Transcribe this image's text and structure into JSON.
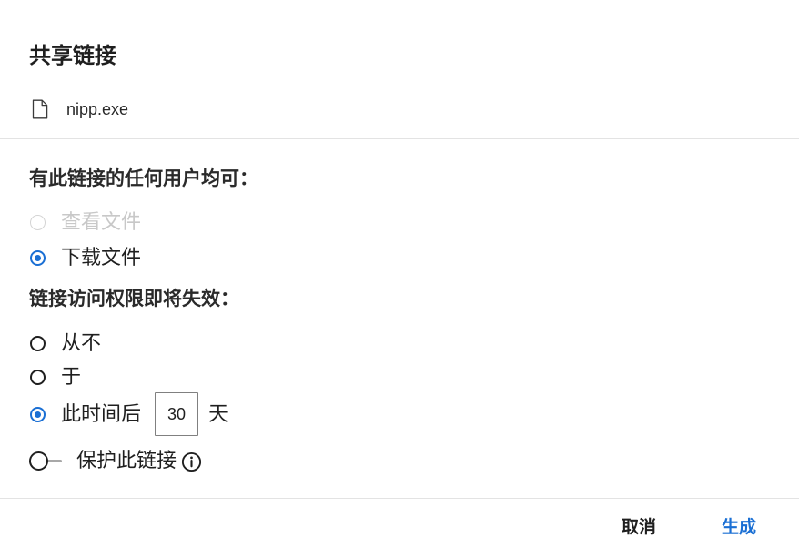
{
  "dialog": {
    "title": "共享链接",
    "file": {
      "icon": "file-icon",
      "name": "nipp.exe"
    },
    "permissions": {
      "heading": "有此链接的任何用户均可：",
      "options": [
        {
          "label": "查看文件",
          "selected": false,
          "disabled": true
        },
        {
          "label": "下载文件",
          "selected": true,
          "disabled": false
        }
      ]
    },
    "expiry": {
      "heading": "链接访问权限即将失效：",
      "options": [
        {
          "label": "从不",
          "selected": false
        },
        {
          "label": "于",
          "selected": false
        },
        {
          "label": "此时间后",
          "selected": true
        }
      ],
      "days_value": "30",
      "days_unit": "天"
    },
    "protect": {
      "label": "保护此链接",
      "enabled": false,
      "info_icon": "info-icon"
    },
    "footer": {
      "cancel_label": "取消",
      "generate_label": "生成"
    }
  },
  "colors": {
    "accent": "#1a6fd4",
    "disabled_text": "#c8c8c8",
    "divider": "#e3e3e3"
  }
}
